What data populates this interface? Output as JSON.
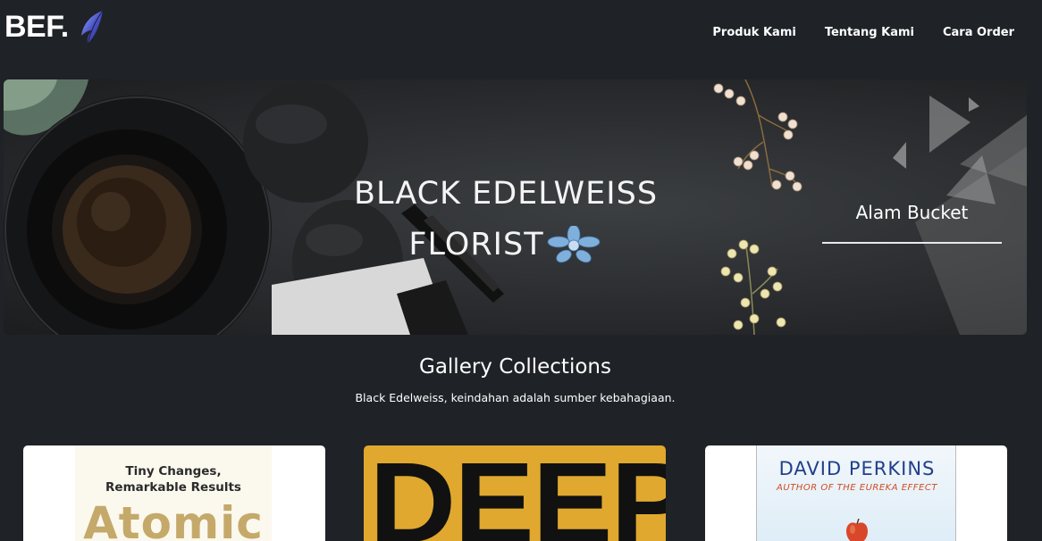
{
  "navbar": {
    "brand": "BEF.",
    "brand_icon": "butterfly-wing-icon",
    "links": [
      "Produk Kami",
      "Tentang Kami",
      "Cara Order"
    ]
  },
  "hero": {
    "title_line1": "BLACK EDELWEISS",
    "title_line2": "FLORIST",
    "flower_icon": "blue-flower-icon",
    "cta_label": "Alam Bucket"
  },
  "gallery": {
    "title": "Gallery Collections",
    "subtitle": "Black Edelweiss, keindahan adalah sumber kebahagiaan.",
    "cards": [
      {
        "line1": "Tiny Changes,",
        "line2": "Remarkable Results",
        "big": "Atomic"
      },
      {
        "big": "DEEP"
      },
      {
        "author": "DAVID PERKINS",
        "sub_prefix": "AUTHOR OF ",
        "sub_title": "THE EUREKA EFFECT"
      }
    ]
  },
  "colors": {
    "background": "#1f2227",
    "text": "#ffffff",
    "card2_yellow": "#e0a82e",
    "author_blue": "#21408a"
  }
}
